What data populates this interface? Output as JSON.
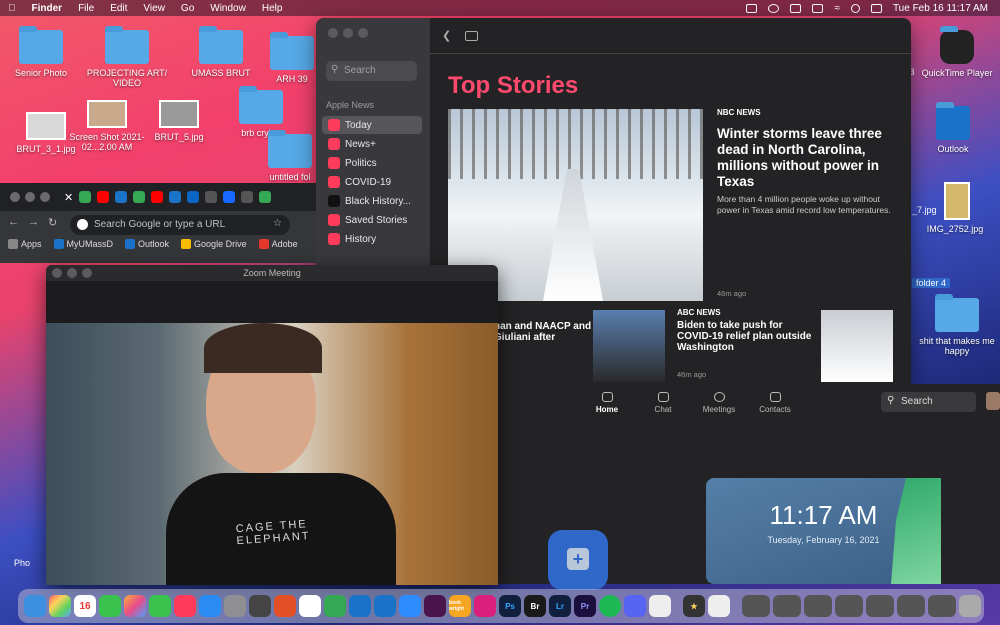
{
  "menubar": {
    "apple": "",
    "items": [
      "Finder",
      "File",
      "Edit",
      "View",
      "Go",
      "Window",
      "Help"
    ],
    "datetime": "Tue Feb 16  11:17 AM"
  },
  "desktop": {
    "senior_photo": "Senior Photo",
    "projecting_art": "PROJECTING ART/ VIDEO",
    "umass_brut": "UMASS BRUT",
    "arh": "ARH 39",
    "screenshot": "Screen Shot 2021-02...2.00 AM",
    "brut3": "BRUT_3_1.jpg",
    "brut5": "BRUT_5.jpg",
    "brb": "brb crying",
    "untitled": "untitled fol",
    "quicktime": "QuickTime Player",
    "quicktime_prefix": "r 3",
    "outlook": "Outlook",
    "img2752": "IMG_2752.jpg",
    "jpg7": "_7.jpg",
    "folder4": "folder 4",
    "shit": "shit that makes me happy",
    "photo": "Pho"
  },
  "news": {
    "search_placeholder": "Search",
    "section": "Apple News",
    "nav": [
      {
        "label": "Today"
      },
      {
        "label": "News+"
      },
      {
        "label": "Politics"
      },
      {
        "label": "COVID-19"
      },
      {
        "label": "Black History..."
      },
      {
        "label": "Saved Stories"
      },
      {
        "label": "History"
      }
    ],
    "top_stories": "Top Stories",
    "lead": {
      "source": "NBC NEWS",
      "headline": "Winter storms leave three dead in North Carolina, millions without power in Texas",
      "summary": "More than 4 million people woke up without power in Texas amid record low temperatures.",
      "age": "46m ago"
    },
    "story2": {
      "headline": "han and NAACP and Giuliani after"
    },
    "story3": {
      "source": "ABC NEWS",
      "headline": "Biden to take push for COVID-19 relief plan outside Washington",
      "age": "46m ago"
    }
  },
  "zoom": {
    "tabs": [
      "Home",
      "Chat",
      "Meetings",
      "Contacts"
    ],
    "search": "Search",
    "time": "11:17 AM",
    "date": "Tuesday, February 16, 2021",
    "meeting_title": "Zoom Meeting",
    "shirt_text": "CAGE THE ELEPHANT"
  },
  "chrome": {
    "omnibox": "Search Google or type a URL",
    "bookmarks": [
      "Apps",
      "MyUMassD",
      "Outlook",
      "Google Drive",
      "Adobe"
    ]
  },
  "dock": {
    "calendar_day": "16",
    "books_label": "book wright"
  },
  "colors": {
    "news_accent": "#ff4a6e",
    "zoom_blue": "#2f68c9"
  }
}
